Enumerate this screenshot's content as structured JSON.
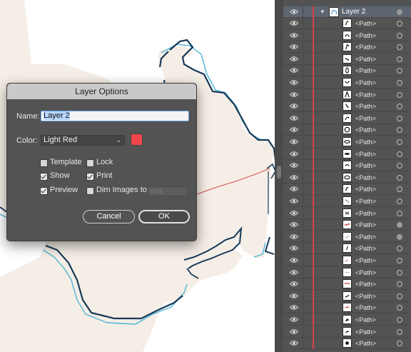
{
  "dialog": {
    "title": "Layer Options",
    "name_label": "Name:",
    "name_value": "Layer 2",
    "color_label": "Color:",
    "color_value": "Light Red",
    "color_swatch": "#f0454b",
    "template_label": "Template",
    "template_checked": false,
    "lock_label": "Lock",
    "lock_checked": false,
    "show_label": "Show",
    "show_checked": true,
    "print_label": "Print",
    "print_checked": true,
    "preview_label": "Preview",
    "preview_checked": true,
    "dim_label": "Dim Images to:",
    "dim_checked": false,
    "dim_value": "50%",
    "cancel_label": "Cancel",
    "ok_label": "OK"
  },
  "layers": {
    "parent_name": "Layer 2",
    "layer_color": "#d8404a",
    "row_label": "<Path>",
    "row_count": 28
  }
}
